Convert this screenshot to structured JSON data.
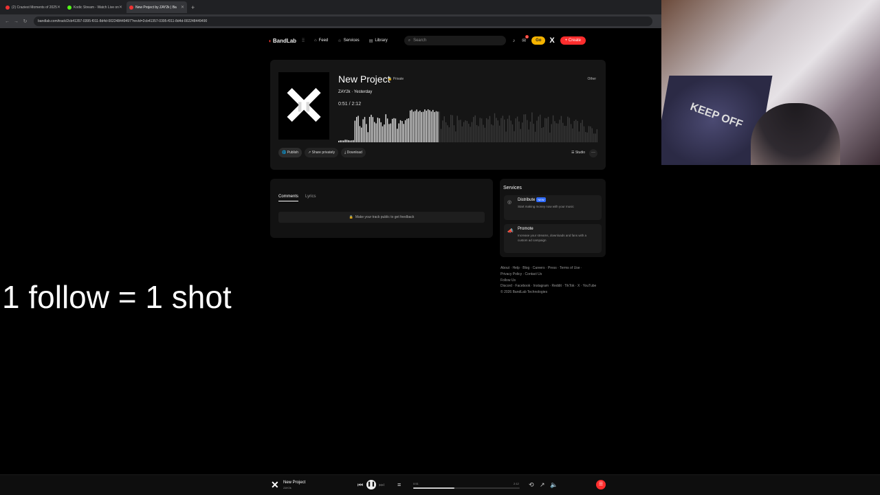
{
  "browser": {
    "tabs": [
      {
        "label": "(2) Craziest Moments of 2025",
        "color": "#e33"
      },
      {
        "label": "Kodic Stream - Watch Live on",
        "color": "#53fc18"
      },
      {
        "label": "New Project by ZAY2k | Ba",
        "color": "#e33"
      }
    ],
    "url": "bandlab.com/track/2cb41357-0395-f011-8d4d-002248449497?revId=2cb41357-0395-f011-8d4d-002248449490",
    "new_tab": "+"
  },
  "site": {
    "logo": "BandLab",
    "nav": {
      "feed": "Feed",
      "services": "Services",
      "library": "Library"
    },
    "search_placeholder": "Search",
    "notification_count": "1",
    "go_label": "Go",
    "x_label": "X",
    "create_label": "+ Create"
  },
  "track": {
    "title": "New Project",
    "privacy": "Private",
    "genre": "Other",
    "artist_line": "ZAY2k · Yesterday",
    "time": "0:51 / 2:12",
    "progress": 0.386,
    "actions": {
      "publish": "Publish",
      "share": "Share privately",
      "download": "Download",
      "studio": "Studio",
      "more": "···"
    }
  },
  "comments": {
    "tabs": {
      "comments": "Comments",
      "lyrics": "Lyrics"
    },
    "notice": "Make your track public to get feedback"
  },
  "services": {
    "title": "Services",
    "distribute": {
      "name": "Distribute",
      "badge": "NEW",
      "desc": "Start making money now with your music"
    },
    "promote": {
      "name": "Promote",
      "desc": "Increase your streams, downloads and fans with a custom ad campaign"
    }
  },
  "footer": {
    "line1": "About · Help · Blog · Careers · Press · Terms of Use ·",
    "line2": "Privacy Policy · Contact Us",
    "line3": "Follow Us",
    "line4": "Discord · Facebook · Instagram · Reddit · TikTok · X · YouTube",
    "line5": "© 2026 BandLab Technologies"
  },
  "overlay": {
    "text": "1 follow = 1 shot"
  },
  "player": {
    "title": "New Project",
    "artist": "ZAY2k",
    "current": "0:51",
    "duration": "2:12",
    "progress": 0.386
  }
}
